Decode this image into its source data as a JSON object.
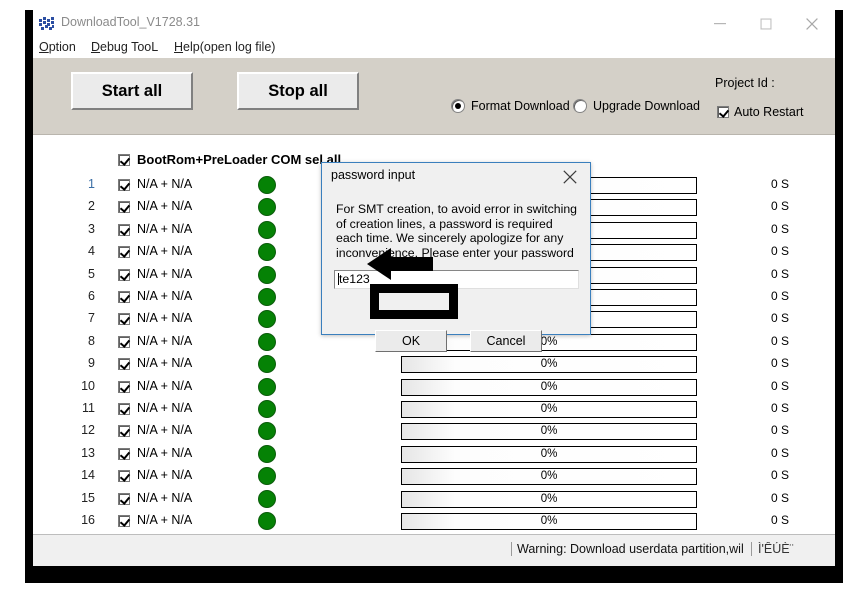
{
  "window": {
    "title": "DownloadTool_V1728.31",
    "icon": "app-icon",
    "minimize_label": "—",
    "maximize_label": "□",
    "close_label": "✕"
  },
  "menubar": {
    "items": [
      {
        "accel": "O",
        "rest": "ption"
      },
      {
        "accel": "D",
        "rest": "ebug TooL"
      },
      {
        "accel": "H",
        "rest": "elp(open log file)"
      }
    ]
  },
  "toolbar": {
    "start_all_label": "Start all",
    "stop_all_label": "Stop all",
    "format_download_label": "Format Download",
    "format_download_selected": true,
    "upgrade_download_label": "Upgrade Download",
    "upgrade_download_selected": false,
    "project_id_label": "Project Id :",
    "project_id_value": "",
    "auto_restart_label": "Auto Restart",
    "auto_restart_checked": true
  },
  "list": {
    "header_label": "BootRom+PreLoader COM sel all",
    "header_checked": true,
    "rows": [
      {
        "num": "1",
        "label": "N/A + N/A",
        "checked": true,
        "led": "green",
        "progress": "0%",
        "time": "0 S"
      },
      {
        "num": "2",
        "label": "N/A + N/A",
        "checked": true,
        "led": "green",
        "progress": "0%",
        "time": "0 S"
      },
      {
        "num": "3",
        "label": "N/A + N/A",
        "checked": true,
        "led": "green",
        "progress": "0%",
        "time": "0 S"
      },
      {
        "num": "4",
        "label": "N/A + N/A",
        "checked": true,
        "led": "green",
        "progress": "0%",
        "time": "0 S"
      },
      {
        "num": "5",
        "label": "N/A + N/A",
        "checked": true,
        "led": "green",
        "progress": "0%",
        "time": "0 S"
      },
      {
        "num": "6",
        "label": "N/A + N/A",
        "checked": true,
        "led": "green",
        "progress": "0%",
        "time": "0 S"
      },
      {
        "num": "7",
        "label": "N/A + N/A",
        "checked": true,
        "led": "green",
        "progress": "0%",
        "time": "0 S"
      },
      {
        "num": "8",
        "label": "N/A + N/A",
        "checked": true,
        "led": "green",
        "progress": "0%",
        "time": "0 S"
      },
      {
        "num": "9",
        "label": "N/A + N/A",
        "checked": true,
        "led": "green",
        "progress": "0%",
        "time": "0 S"
      },
      {
        "num": "10",
        "label": "N/A + N/A",
        "checked": true,
        "led": "green",
        "progress": "0%",
        "time": "0 S"
      },
      {
        "num": "11",
        "label": "N/A + N/A",
        "checked": true,
        "led": "green",
        "progress": "0%",
        "time": "0 S"
      },
      {
        "num": "12",
        "label": "N/A + N/A",
        "checked": true,
        "led": "green",
        "progress": "0%",
        "time": "0 S"
      },
      {
        "num": "13",
        "label": "N/A + N/A",
        "checked": true,
        "led": "green",
        "progress": "0%",
        "time": "0 S"
      },
      {
        "num": "14",
        "label": "N/A + N/A",
        "checked": true,
        "led": "green",
        "progress": "0%",
        "time": "0 S"
      },
      {
        "num": "15",
        "label": "N/A + N/A",
        "checked": true,
        "led": "green",
        "progress": "0%",
        "time": "0 S"
      },
      {
        "num": "16",
        "label": "N/A + N/A",
        "checked": true,
        "led": "green",
        "progress": "0%",
        "time": "0 S"
      }
    ]
  },
  "statusbar": {
    "warning": "Warning: Download userdata partition,will lo",
    "extra": "Ì'ÊÚÈ¨"
  },
  "dialog": {
    "title": "password input",
    "close_label": "✕",
    "message": "For SMT creation, to avoid error in switching of creation lines, a password is required each time. We sincerely apologize for any inconvenience. Please enter your password",
    "password_value": "te123",
    "password_placeholder": "",
    "ok_label": "OK",
    "cancel_label": "Cancel"
  },
  "colors": {
    "led_green": "#058205",
    "dialog_border": "#3a7fbd",
    "toolbar_gray": "#d4d0c8",
    "annotation_black": "#000000",
    "row_first_blue": "#3a6ea5"
  }
}
